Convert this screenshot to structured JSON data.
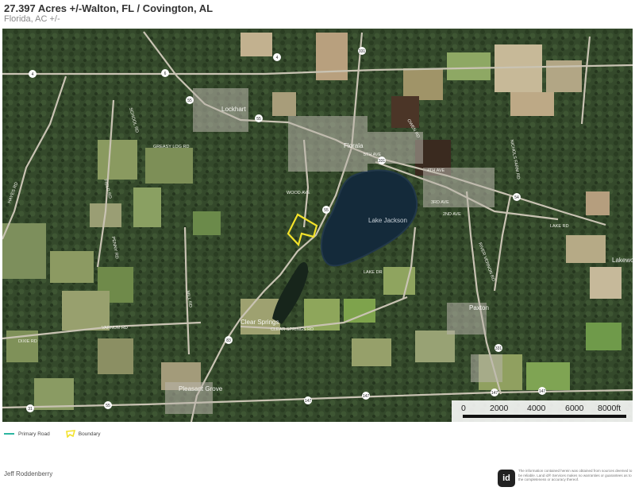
{
  "header": {
    "title": "27.397 Acres +/-Walton, FL / Covington, AL",
    "subtitle": "Florida,  AC +/-"
  },
  "map": {
    "places": [
      "Lockhart",
      "Florala",
      "Lake Jackson",
      "Clear Springs",
      "Paxton",
      "Pleasant Grove",
      "Lakewo"
    ],
    "roads": [
      "GREASY LOG RD",
      "WOOD AVE",
      "CLEAR SPRINGS RD",
      "LAKE DR",
      "RIVER VERNON RD",
      "4TH AVE",
      "2ND AVE",
      "3RD AVE",
      "5TH AVE",
      "LAKE RD",
      "HAYES RD",
      "MILL RD",
      "PENNY RD",
      "FIELD RD",
      "SCHOOL RD",
      "VARNUM RD",
      "NICHOLS FARM RD",
      "DIXIE RD",
      "OWEN RD"
    ],
    "route_shields": [
      "4",
      "4",
      "6",
      "55",
      "55",
      "55",
      "331",
      "331",
      "331",
      "54",
      "83",
      "147",
      "147",
      "147",
      "147",
      "55",
      "31"
    ],
    "colors": {
      "boundary": "#f3e22b",
      "primary_road": "#2bb5a0",
      "lake": "#142a3a"
    }
  },
  "scale": {
    "ticks": [
      "0",
      "2000",
      "4000",
      "6000",
      "8000ft"
    ]
  },
  "legend": {
    "road_label": "Primary Road",
    "boundary_label": "Boundary"
  },
  "footer": {
    "agent": "Jeff Roddenberry",
    "logo_text": "id",
    "disclaimer": "The information contained herein was obtained from sources deemed to be reliable. Land id® Services makes no warranties or guarantees as to the completeness or accuracy thereof."
  }
}
